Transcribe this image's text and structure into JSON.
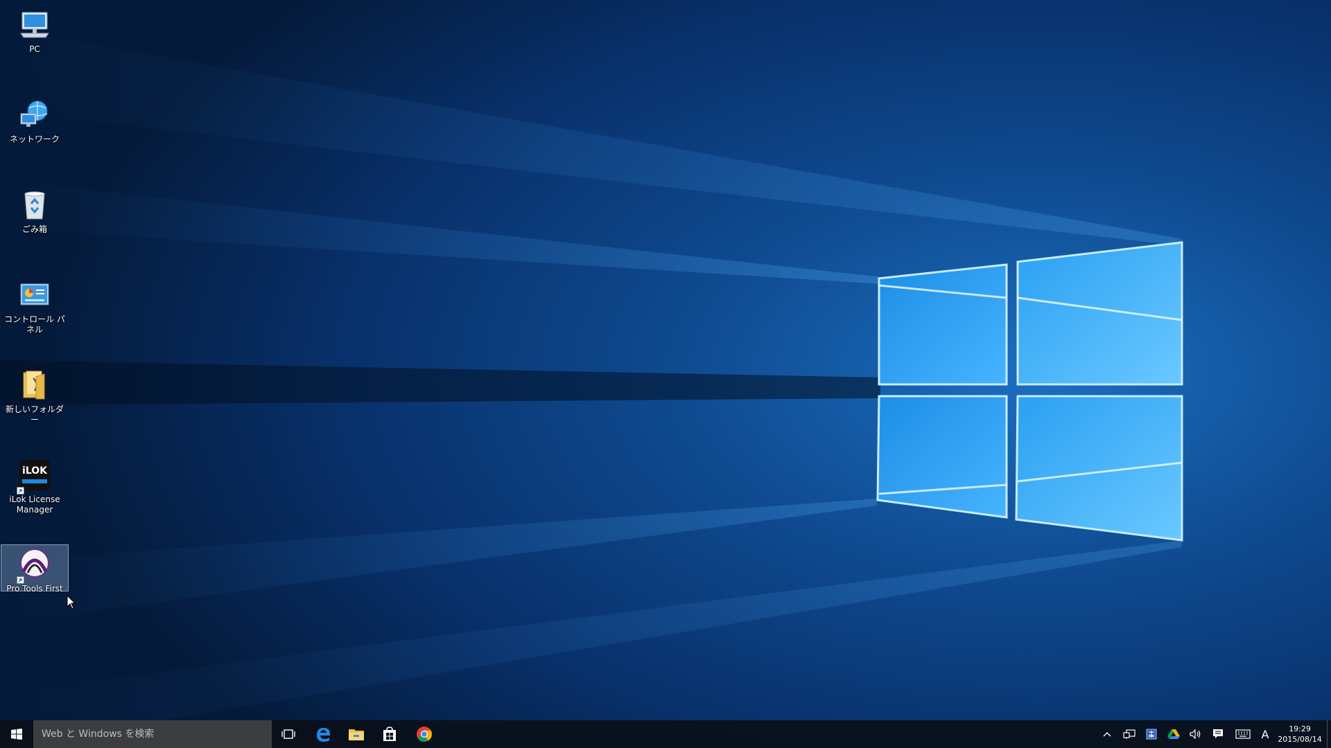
{
  "desktop": {
    "icons": [
      {
        "label": "PC",
        "icon": "pc-icon"
      },
      {
        "label": "ネットワーク",
        "icon": "network-icon"
      },
      {
        "label": "ごみ箱",
        "icon": "recycle-bin-icon"
      },
      {
        "label": "コントロール パネル",
        "icon": "control-panel-icon"
      },
      {
        "label": "新しいフォルダー",
        "icon": "folder-icon"
      },
      {
        "label": "iLok License Manager",
        "icon": "ilok-icon"
      },
      {
        "label": "Pro Tools First",
        "icon": "pro-tools-icon",
        "selected": true
      }
    ],
    "ilok_logo_text": "iLOK"
  },
  "taskbar": {
    "search_placeholder": "Web と Windows を検索",
    "pinned": [
      "task-view-icon",
      "edge-icon",
      "file-explorer-icon",
      "store-icon",
      "chrome-icon"
    ],
    "tray_icons": [
      "show-hidden-icons-chevron",
      "network-tray-icon",
      "ime-pad-icon",
      "google-drive-icon",
      "volume-icon",
      "action-center-icon",
      "touch-keyboard-icon"
    ],
    "ime_mode": "A",
    "clock_time": "19:29",
    "clock_date": "2015/08/14"
  },
  "colors": {
    "taskbar": "#0a101a",
    "accent": "#1e90ff",
    "wallpaper_dark": "#041a3a",
    "wallpaper_light": "#1b8fe8"
  }
}
